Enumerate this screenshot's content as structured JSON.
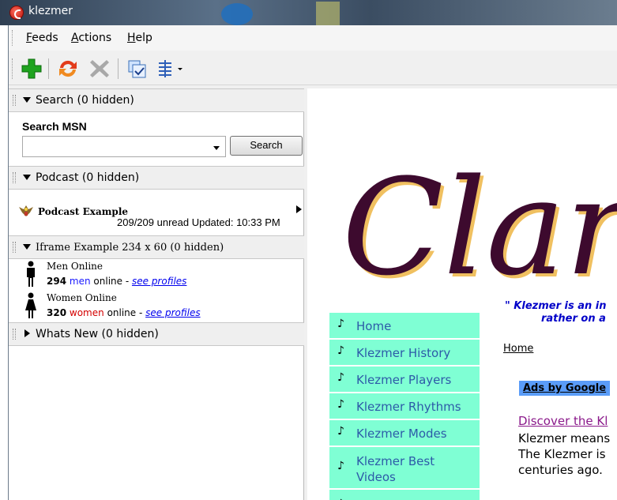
{
  "window": {
    "title": "klezmer"
  },
  "menu": {
    "items": [
      {
        "accel": "F",
        "rest": "eeds"
      },
      {
        "accel": "A",
        "rest": "ctions"
      },
      {
        "accel": "H",
        "rest": "elp"
      }
    ]
  },
  "toolbar": {
    "icons": [
      "add-icon",
      "refresh-icon",
      "delete-icon",
      "settings-icon",
      "view-options-icon"
    ]
  },
  "sections": {
    "search": {
      "header": "Search (0 hidden)",
      "title": "Search MSN",
      "input_value": "",
      "button": "Search"
    },
    "podcast": {
      "header": "Podcast (0 hidden)",
      "name": "Podcast Example",
      "stats": "209/209 unread   Updated: 10:33 PM"
    },
    "iframe": {
      "header": "Iframe Example 234 x 60 (0 hidden)",
      "men": {
        "label": "Men Online",
        "count": "294",
        "word": "men",
        "suffix": "online -",
        "link": "see profiles"
      },
      "women": {
        "label": "Women Online",
        "count": "320",
        "word": "women",
        "suffix": "online -",
        "link": "see profiles"
      }
    },
    "whatsnew": {
      "header": "Whats New (0 hidden)"
    }
  },
  "page": {
    "logo_text": "Clari",
    "tagline_line1": "\" Klezmer is an in",
    "tagline_line2": "rather on a",
    "home_link": "Home",
    "ads_label": "Ads by Google",
    "discover": "Discover the Kl",
    "body_lines": [
      "Klezmer means",
      "The Klezmer is",
      "centuries ago."
    ],
    "nav": [
      {
        "label": "Home"
      },
      {
        "label": "Klezmer History"
      },
      {
        "label": "Klezmer Players"
      },
      {
        "label": "Klezmer Rhythms"
      },
      {
        "label": "Klezmer Modes"
      },
      {
        "label": "Klezmer Best",
        "label2": "Videos"
      }
    ]
  },
  "colors": {
    "nav_bg": "#7fffd4",
    "nav_text": "#2d5aa8",
    "logo": "#3d0a2e",
    "logo_shadow": "#f0c060",
    "tagline": "#0000c8"
  }
}
